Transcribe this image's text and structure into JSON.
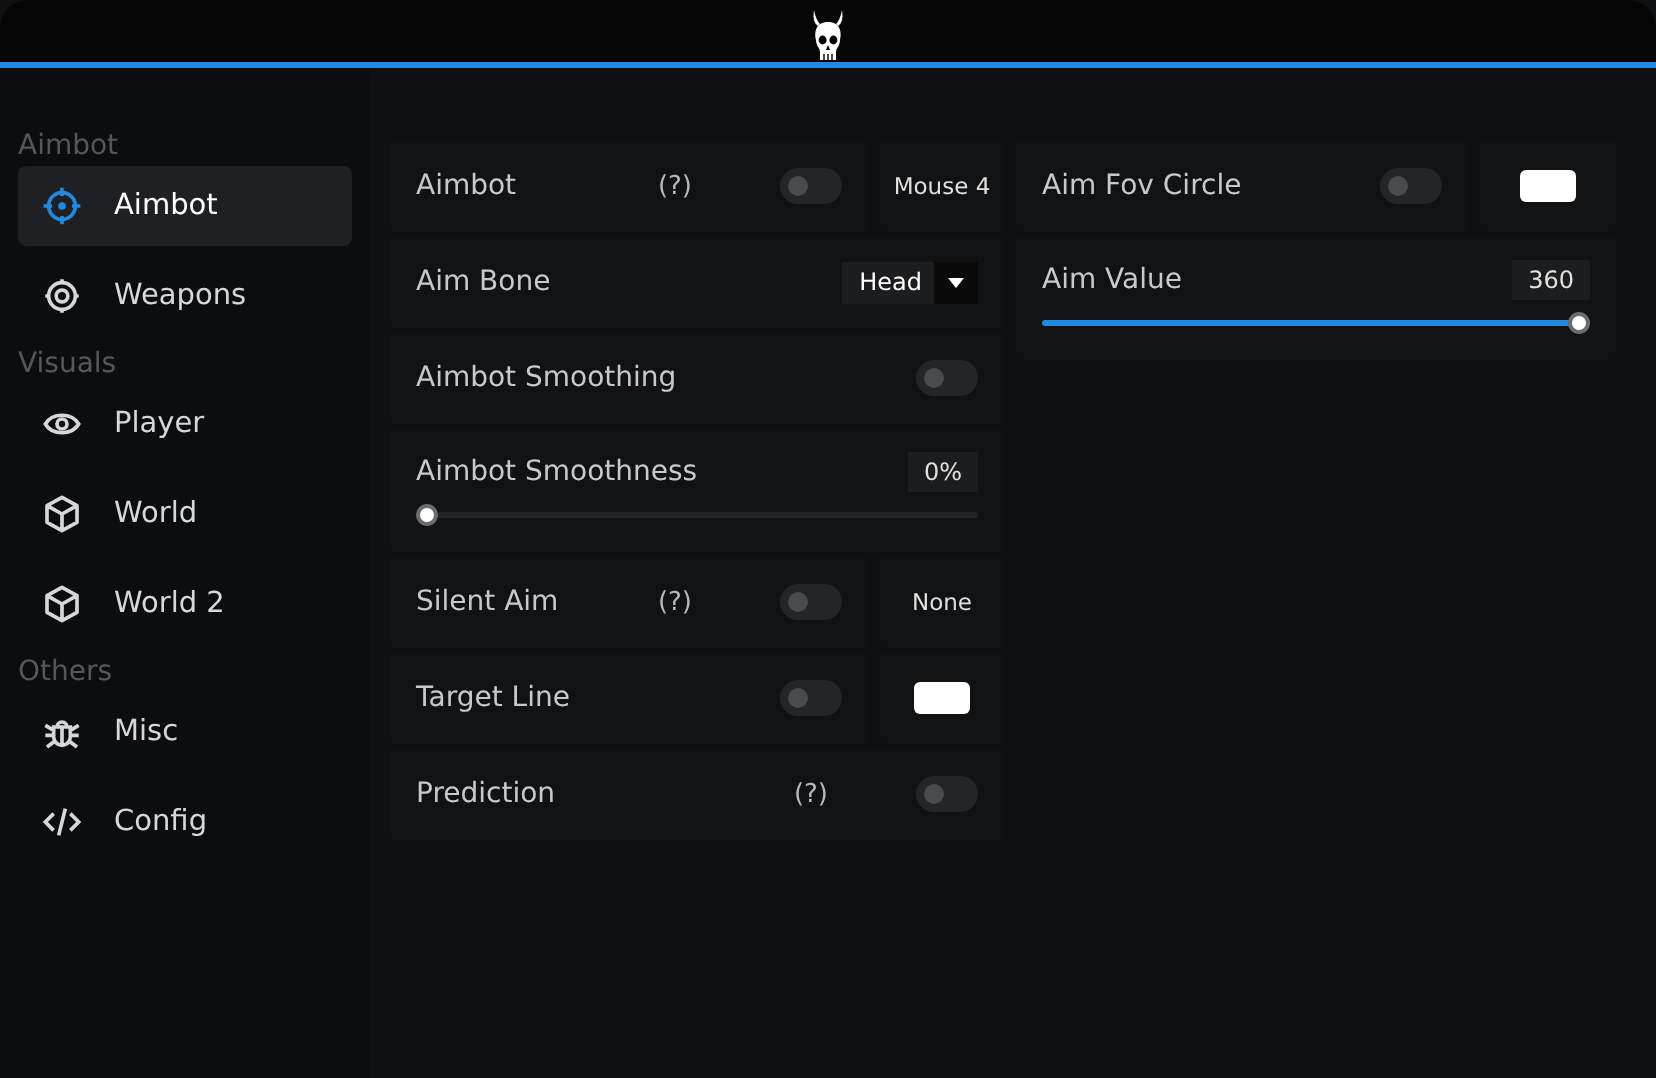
{
  "sidebar": {
    "sections": [
      {
        "title": "Aimbot",
        "items": [
          {
            "label": "Aimbot",
            "selected": true
          },
          {
            "label": "Weapons",
            "selected": false
          }
        ]
      },
      {
        "title": "Visuals",
        "items": [
          {
            "label": "Player",
            "selected": false
          },
          {
            "label": "World",
            "selected": false
          },
          {
            "label": "World 2",
            "selected": false
          }
        ]
      },
      {
        "title": "Others",
        "items": [
          {
            "label": "Misc",
            "selected": false
          },
          {
            "label": "Config",
            "selected": false
          }
        ]
      }
    ]
  },
  "columns": [
    [
      {
        "kind": "toggle",
        "label": "Aimbot",
        "help": "(?)",
        "on": false,
        "side": {
          "kind": "key",
          "text": "Mouse 4"
        }
      },
      {
        "kind": "dropdown",
        "label": "Aim Bone",
        "value": "Head"
      },
      {
        "kind": "toggle",
        "label": "Aimbot Smoothing",
        "on": false
      },
      {
        "kind": "slider",
        "label": "Aimbot Smoothness",
        "value": "0%",
        "level": 0
      },
      {
        "kind": "toggle",
        "label": "Silent Aim",
        "help": "(?)",
        "on": false,
        "side": {
          "kind": "key",
          "text": "None"
        }
      },
      {
        "kind": "toggle",
        "label": "Target Line",
        "on": false,
        "side": {
          "kind": "color",
          "color": "#ffffff"
        }
      },
      {
        "kind": "toggle",
        "label": "Prediction",
        "help": "(?)",
        "on": false
      }
    ],
    [
      {
        "kind": "toggle",
        "label": "Aim Fov Circle",
        "on": false,
        "side": {
          "kind": "color",
          "color": "#ffffff"
        }
      },
      {
        "kind": "slider",
        "label": "Aim Value",
        "value": "360",
        "level": 1
      }
    ]
  ]
}
